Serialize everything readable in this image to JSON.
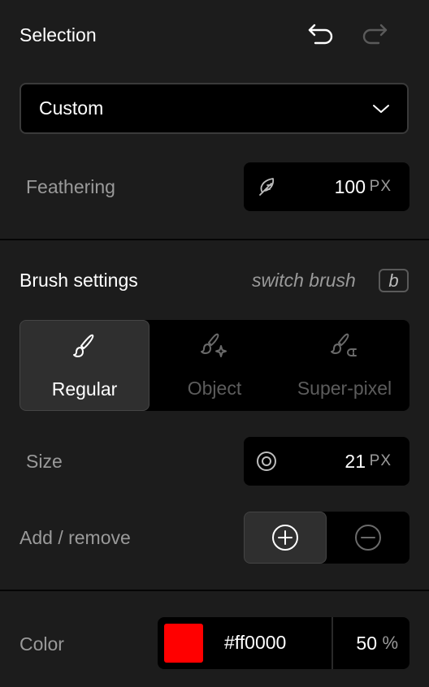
{
  "selection": {
    "title": "Selection",
    "undo_icon": "undo-icon",
    "redo_icon": "redo-icon",
    "mode_value": "Custom",
    "feathering_label": "Feathering",
    "feathering_value": "100",
    "feathering_unit": "PX",
    "feather_icon": "feather-icon"
  },
  "brush": {
    "title": "Brush settings",
    "switch_hint": "switch brush",
    "switch_key": "b",
    "options": [
      {
        "label": "Regular",
        "icon": "paintbrush-icon",
        "active": true
      },
      {
        "label": "Object",
        "icon": "brush-sparkle-icon",
        "active": false
      },
      {
        "label": "Super-pixel",
        "icon": "brush-magnet-icon",
        "active": false
      }
    ],
    "size_label": "Size",
    "size_value": "21",
    "size_unit": "PX",
    "add_remove_label": "Add / remove",
    "add_active": true
  },
  "color": {
    "label": "Color",
    "swatch": "#ff0000",
    "hex": "#ff0000",
    "opacity_value": "50",
    "opacity_unit": "%"
  },
  "theme": {
    "background": "#1c1c1c",
    "field": "#000000",
    "active_segment": "#2f2f2f",
    "muted_text": "#9a9a9a"
  }
}
